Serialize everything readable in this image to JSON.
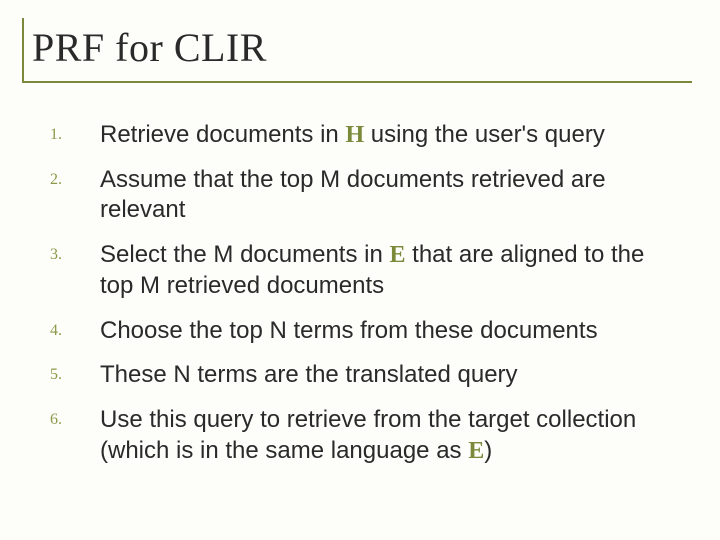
{
  "title": "PRF for CLIR",
  "langH": "H",
  "langE": "E",
  "items": [
    {
      "n": "1.",
      "pre": "Retrieve documents in ",
      "lang": "H",
      "post": " using the user's query"
    },
    {
      "n": "2.",
      "pre": "Assume that the top M documents retrieved are relevant",
      "lang": "",
      "post": ""
    },
    {
      "n": "3.",
      "pre": "Select the M documents in ",
      "lang": "E",
      "post": " that are aligned to the top M retrieved documents"
    },
    {
      "n": "4.",
      "pre": "Choose the top N terms from these documents",
      "lang": "",
      "post": ""
    },
    {
      "n": "5.",
      "pre": "These N terms are the translated query",
      "lang": "",
      "post": ""
    },
    {
      "n": "6.",
      "pre": "Use this query to retrieve from the target collection (which is in the same language as ",
      "lang": "E",
      "post": ")"
    }
  ]
}
